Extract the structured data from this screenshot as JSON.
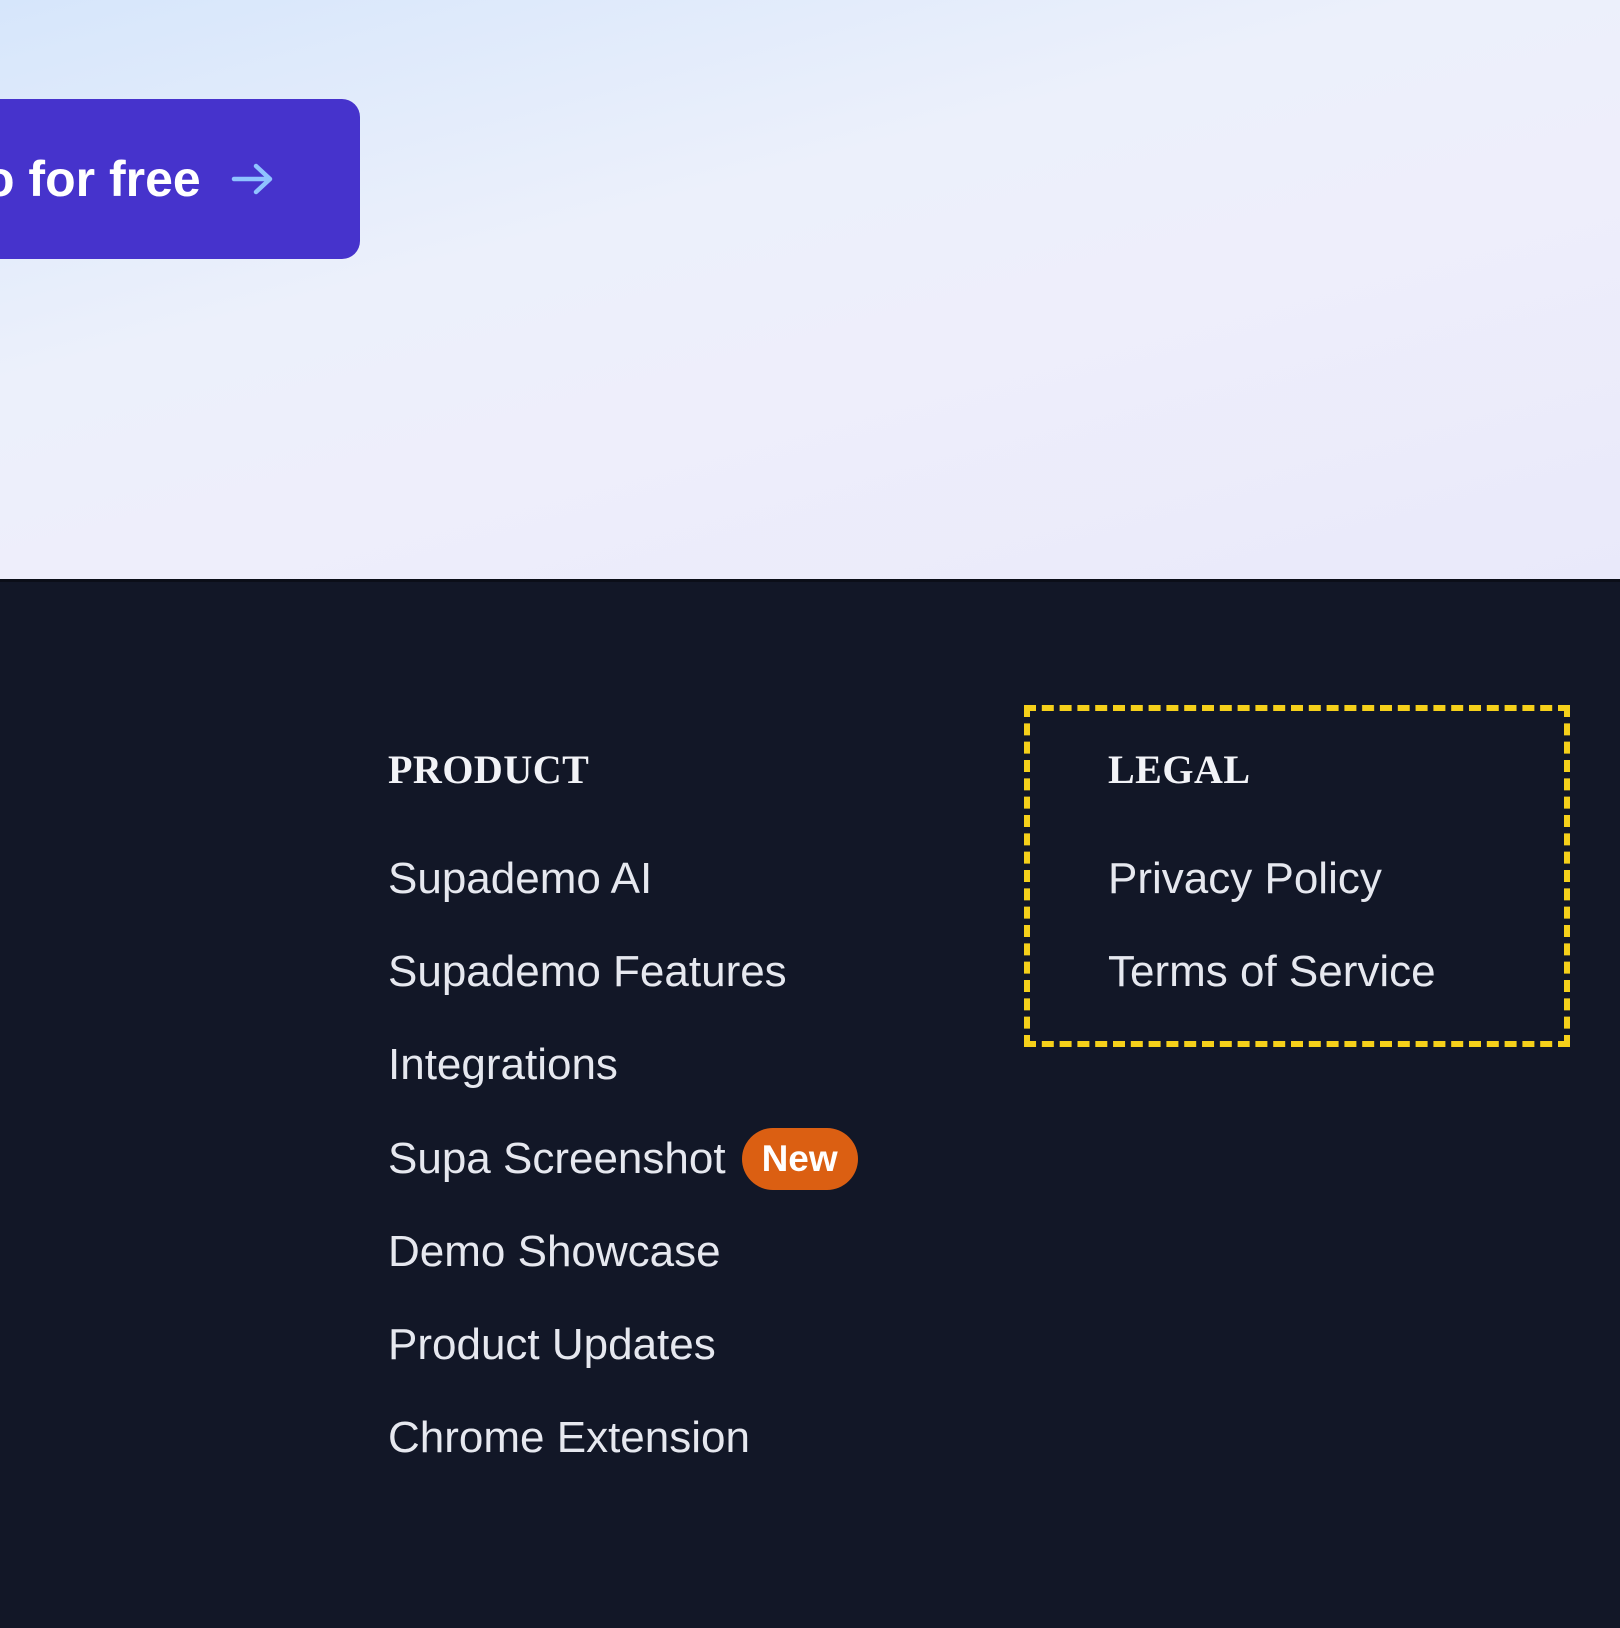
{
  "hero": {
    "cta_label": "o for free"
  },
  "footer": {
    "product": {
      "heading": "PRODUCT",
      "links": [
        "Supademo AI",
        "Supademo Features",
        "Integrations",
        "Supa Screenshot",
        "Demo Showcase",
        "Product Updates",
        "Chrome Extension"
      ],
      "new_badge": "New"
    },
    "legal": {
      "heading": "LEGAL",
      "links": [
        "Privacy Policy",
        "Terms of Service"
      ]
    }
  },
  "colors": {
    "cta_background": "#4633cc",
    "cta_arrow": "#8fc3ff",
    "footer_background": "#121727",
    "new_badge": "#db5f12",
    "highlight_border": "#f5d01a"
  },
  "icons": {
    "cta_arrow": "arrow-right-icon"
  }
}
